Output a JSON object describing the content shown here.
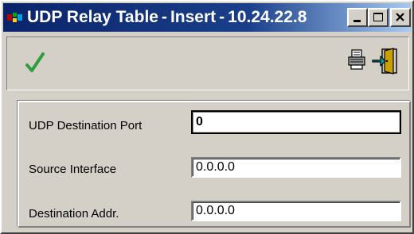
{
  "window": {
    "app_name": "UDP Relay Table",
    "mode": "Insert",
    "host": "10.24.22.8",
    "separator": "-",
    "controls": [
      "minimize",
      "maximize",
      "close"
    ]
  },
  "toolbar": {
    "icons": [
      "checkmark-icon",
      "printer-icon",
      "exit-door-icon"
    ],
    "colors": {
      "checkmark": "#2e9e3c",
      "exit_accent": "#00a0a0"
    }
  },
  "form": {
    "fields": [
      {
        "label": "UDP Destination Port",
        "value": "0",
        "focused": true
      },
      {
        "label": "Source Interface",
        "value": "0.0.0.0",
        "focused": false
      },
      {
        "label": "Destination Addr.",
        "value": "0.0.0.0",
        "focused": false
      }
    ]
  },
  "colors": {
    "title_bar_start": "#0a246a",
    "title_bar_end": "#a6caf0",
    "face": "#d4d0c8"
  }
}
